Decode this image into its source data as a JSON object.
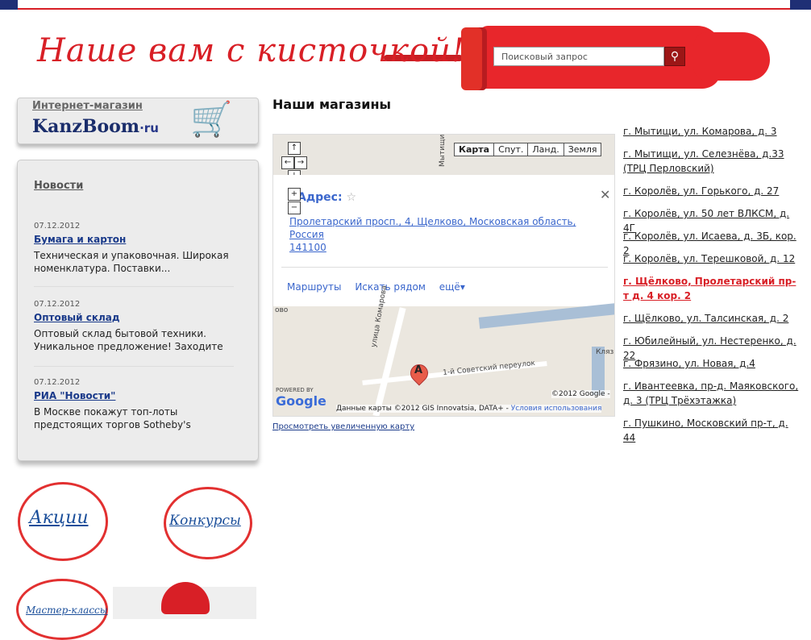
{
  "header": {
    "slogan": "Наше вам с кисточкой!",
    "search_placeholder": "Поисковый запрос",
    "search_button_icon": "search-icon",
    "brand_color": "#d81f26"
  },
  "sidebar": {
    "shop_box": {
      "title": "Интернет-магазин",
      "logo_main": "KanzBoom",
      "logo_suffix": "·ru",
      "icon": "cart-icon"
    },
    "news": {
      "title": "Новости",
      "items": [
        {
          "date": "07.12.2012",
          "title": "Бумага и картон",
          "text": "Техническая и упаковочная. Широкая номенклатура. Поставки..."
        },
        {
          "date": "07.12.2012",
          "title": "Оптовый склад",
          "text": "Оптовый склад бытовой техники. Уникальное предложение! Заходите"
        },
        {
          "date": "07.12.2012",
          "title": "РИА \"Новости\"",
          "text": "В Москве покажут топ-лоты предстоящих торгов Sotheby's"
        }
      ]
    },
    "promos": [
      "Акции",
      "Конкурсы",
      "Мастер-классы"
    ]
  },
  "main": {
    "title": "Наши магазины",
    "map": {
      "map_types": [
        "Карта",
        "Спут.",
        "Ланд.",
        "Земля"
      ],
      "pan_icons": [
        "arrow-up-icon",
        "arrow-left-icon",
        "arrow-right-icon",
        "arrow-down-icon",
        "zoom-in-icon",
        "zoom-out-icon"
      ],
      "pan_glyphs": [
        "↑",
        "←",
        "→",
        "↓",
        "+",
        "−"
      ],
      "info_title": "Адрес:",
      "star": "☆",
      "close": "✕",
      "address_line1": "Пролетарский просп., 4, Щелково, Московская область,",
      "address_line2": "Россия",
      "postcode": "141100",
      "actions": [
        "Маршруты",
        "Искать рядом",
        "ещё▾"
      ],
      "marker_label": "A",
      "streets": [
        "улица Комарова",
        "1-й Советский переулок",
        "Мытищинский",
        "Клязьма",
        "ово"
      ],
      "powered_by": "POWERED BY",
      "google_logo": "Google",
      "copyright": "©2012 Google -",
      "attribution": "Данные карты ©2012 GIS Innovatsia, DATA+ -",
      "terms": "Условия использования"
    },
    "enlarge_link": "Просмотреть увеличенную карту"
  },
  "stores": [
    {
      "label": "г. Мытищи, ул. Комарова, д. 3",
      "active": false
    },
    {
      "label": "г. Мытищи, ул. Селезнёва, д.33 (ТРЦ Перловский)",
      "active": false
    },
    {
      "label": "г. Королёв, ул. Горького, д. 27",
      "active": false
    },
    {
      "label": "г. Королёв, ул. 50 лет ВЛКСМ, д. 4Г",
      "active": false
    },
    {
      "label": "г. Королёв, ул. Исаева, д. 3Б, кор. 2",
      "active": false
    },
    {
      "label": "г. Королёв, ул. Терешковой, д. 12",
      "active": false
    },
    {
      "label": "г. Щёлково, Пролетарский пр-т д. 4 кор. 2",
      "active": true
    },
    {
      "label": "г. Щёлково, ул. Талсинская, д. 2",
      "active": false
    },
    {
      "label": "г. Юбилейный, ул. Нестеренко, д. 22",
      "active": false
    },
    {
      "label": "г. Фрязино, ул. Новая, д.4",
      "active": false
    },
    {
      "label": "г. Ивантеевка, пр-д. Маяковского, д. 3 (ТРЦ Трёхэтажка)",
      "active": false
    },
    {
      "label": "г. Пушкино, Московский пр-т, д. 44",
      "active": false
    }
  ]
}
